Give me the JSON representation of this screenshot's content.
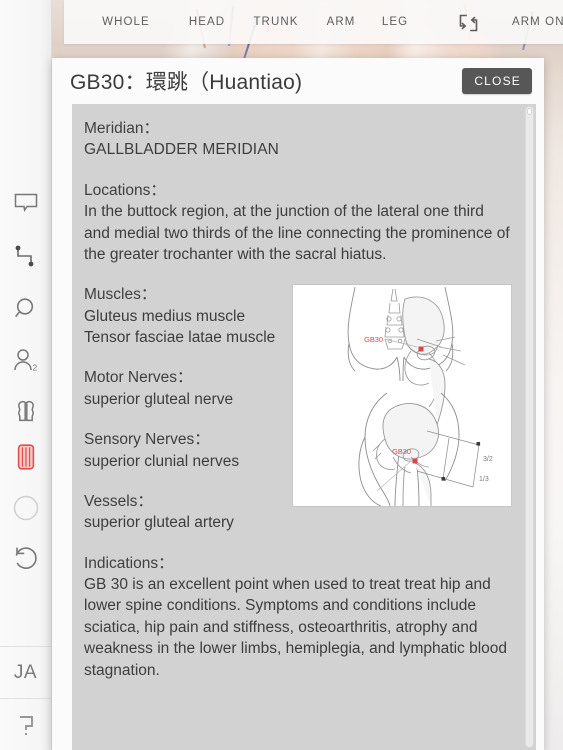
{
  "app": {
    "rail": {
      "items": [
        {
          "name": "speech-bubble-icon",
          "label": "Comment"
        },
        {
          "name": "path-connector-icon",
          "label": "Measure"
        },
        {
          "name": "search-icon",
          "label": "Search"
        },
        {
          "name": "user-layers-icon",
          "label": "Layers",
          "badge": "2"
        },
        {
          "name": "bone-icon",
          "label": "Skeleton"
        },
        {
          "name": "muscle-icon",
          "label": "Muscle",
          "active": true
        },
        {
          "name": "circle-icon",
          "label": "Organ"
        },
        {
          "name": "reset-icon",
          "label": "Reset"
        }
      ],
      "language": "JA",
      "help": "?"
    },
    "tabbar": {
      "tabs": [
        {
          "label": "WHOLE"
        },
        {
          "label": "HEAD"
        },
        {
          "label": "TRUNK"
        },
        {
          "label": "ARM"
        },
        {
          "label": "LEG"
        }
      ],
      "rotate_icon": "rotate-swap-icon",
      "mode_label": "ARM ONLY"
    }
  },
  "dialog": {
    "title": "GB30：環跳（Huantiao)",
    "close_label": "CLOSE",
    "fields": [
      {
        "label": "Meridian：",
        "value": "GALLBLADDER MERIDIAN"
      },
      {
        "label": "Locations：",
        "value": "In the buttock region, at the junction of the lateral one third and medial two thirds of the line connecting the prominence of the greater trochanter with the sacral hiatus."
      },
      {
        "label": "Muscles：",
        "value": "Gluteus medius muscle\nTensor fasciae latae muscle"
      },
      {
        "label": "Motor Nerves：",
        "value": "superior gluteal nerve"
      },
      {
        "label": "Sensory Nerves：",
        "value": "superior clunial nerves"
      },
      {
        "label": "Vessels：",
        "value": "superior gluteal artery"
      },
      {
        "label": "Indications：",
        "value": "GB 30 is an excellent point when used to treat treat hip and lower spine conditions. Symptoms and conditions include sciatica, hip pain and stiffness, osteoarthritis, atrophy and weakness in the lower limbs, hemiplegia, and lymphatic blood stagnation."
      }
    ],
    "figure": {
      "name": "acupoint-anatomy-diagram",
      "point_label_top": "GB30",
      "point_label_bottom": "GB30",
      "cun_label_upper": "3/2",
      "cun_label_lower": "1/3"
    }
  },
  "colors": {
    "accent_red": "#d9454a",
    "muscle_icon": "#e8736f",
    "close_button_bg": "#575757",
    "panel_bg": "#d2d2d2",
    "dialog_bg": "#fbfbfb",
    "text": "#3d3d3d"
  }
}
